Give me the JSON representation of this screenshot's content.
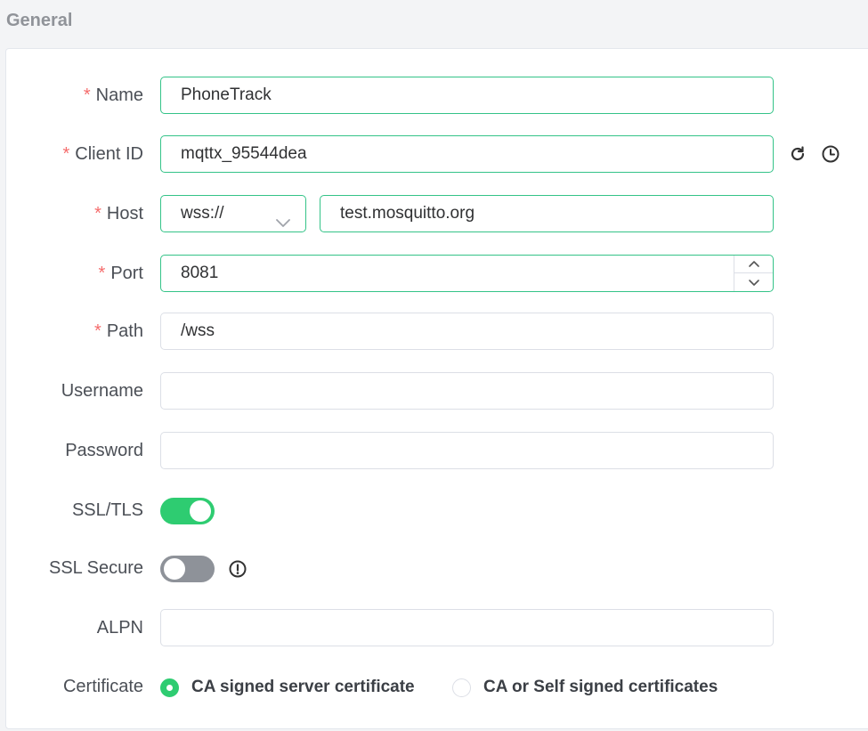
{
  "section": {
    "title": "General"
  },
  "form": {
    "required_mark": "*",
    "name": {
      "label": "Name",
      "value": "PhoneTrack"
    },
    "client_id": {
      "label": "Client ID",
      "value": "mqttx_95544dea",
      "refresh_icon": "refresh-icon",
      "history_icon": "clock-icon"
    },
    "host": {
      "label": "Host",
      "protocol": "wss://",
      "value": "test.mosquitto.org"
    },
    "port": {
      "label": "Port",
      "value": "8081"
    },
    "path": {
      "label": "Path",
      "value": "/wss"
    },
    "username": {
      "label": "Username",
      "value": ""
    },
    "password": {
      "label": "Password",
      "value": ""
    },
    "ssl_tls": {
      "label": "SSL/TLS",
      "enabled": true
    },
    "ssl_secure": {
      "label": "SSL Secure",
      "enabled": false,
      "info_icon": "info-icon"
    },
    "alpn": {
      "label": "ALPN",
      "value": ""
    },
    "certificate": {
      "label": "Certificate",
      "options": [
        {
          "label": "CA signed server certificate",
          "selected": true
        },
        {
          "label": "CA or Self signed certificates",
          "selected": false
        }
      ]
    }
  },
  "colors": {
    "accent": "#34c388",
    "switch_on": "#2ecc71",
    "switch_off": "#8e9299",
    "required": "#f56c6c"
  }
}
